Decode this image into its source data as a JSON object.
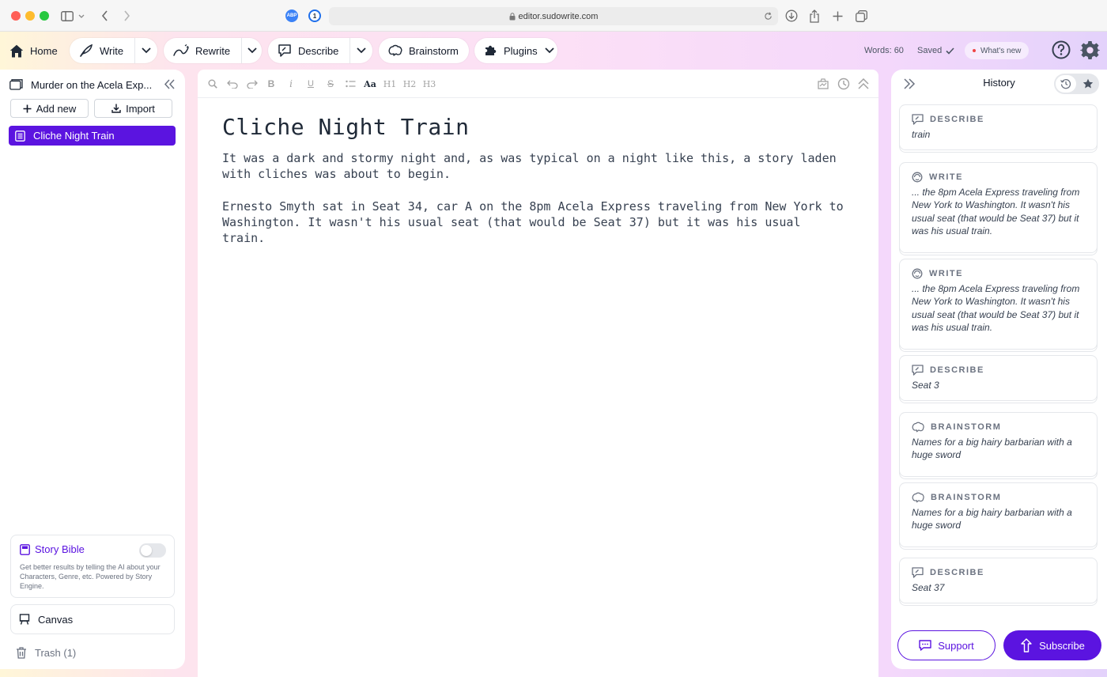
{
  "browser": {
    "url": "editor.sudowrite.com",
    "abp_label": "ABP",
    "onepassword_label": "1"
  },
  "nav": {
    "home": "Home",
    "write": "Write",
    "rewrite": "Rewrite",
    "describe": "Describe",
    "brainstorm": "Brainstorm",
    "plugins": "Plugins",
    "word_count": "Words: 60",
    "saved": "Saved",
    "whats_new": "What's new"
  },
  "sidebar": {
    "project_title": "Murder on the Acela Exp...",
    "add_new": "Add new",
    "import": "Import",
    "documents": [
      {
        "label": "Cliche Night Train",
        "active": true
      }
    ],
    "story_bible": {
      "title": "Story Bible",
      "enabled": false,
      "description": "Get better results by telling the AI about your Characters, Genre, etc. Powered by Story Engine."
    },
    "canvas": "Canvas",
    "trash": "Trash (1)"
  },
  "editor": {
    "toolbar": {
      "h1": "H1",
      "h2": "H2",
      "h3": "H3",
      "font": "Aa",
      "bold": "B",
      "italic": "i",
      "underline": "U",
      "strike": "S"
    },
    "title": "Cliche Night Train",
    "paragraphs": [
      "It was a dark and stormy night and, as was typical on a night like this, a story laden with cliches was about to begin.",
      "Ernesto Smyth sat in Seat 34, car A on the 8pm Acela Express traveling from New York to Washington. It wasn't his usual seat (that would be Seat 37) but it was his usual train."
    ]
  },
  "history": {
    "title": "History",
    "items": [
      {
        "kind": "DESCRIBE",
        "icon": "describe-icon",
        "text": "train"
      },
      {
        "kind": "WRITE",
        "icon": "write-icon",
        "text": "... the 8pm Acela Express traveling from New York to Washington. It wasn't his usual seat (that would be Seat 37) but it was his usual train."
      },
      {
        "kind": "WRITE",
        "icon": "write-icon",
        "text": "... the 8pm Acela Express traveling from New York to Washington. It wasn't his usual seat (that would be Seat 37) but it was his usual train."
      },
      {
        "kind": "DESCRIBE",
        "icon": "describe-icon",
        "text": "Seat 3"
      },
      {
        "kind": "BRAINSTORM",
        "icon": "brainstorm-icon",
        "text": "Names for a big hairy barbarian with a huge sword"
      },
      {
        "kind": "BRAINSTORM",
        "icon": "brainstorm-icon",
        "text": "Names for a big hairy barbarian with a huge sword"
      },
      {
        "kind": "DESCRIBE",
        "icon": "describe-icon",
        "text": "Seat 37"
      }
    ],
    "support": "Support",
    "subscribe": "Subscribe"
  },
  "colors": {
    "accent": "#5b14e0",
    "app_gradient": [
      "#fff6d8",
      "#fde4ee",
      "#fce0f6",
      "#e3d2fb"
    ]
  }
}
